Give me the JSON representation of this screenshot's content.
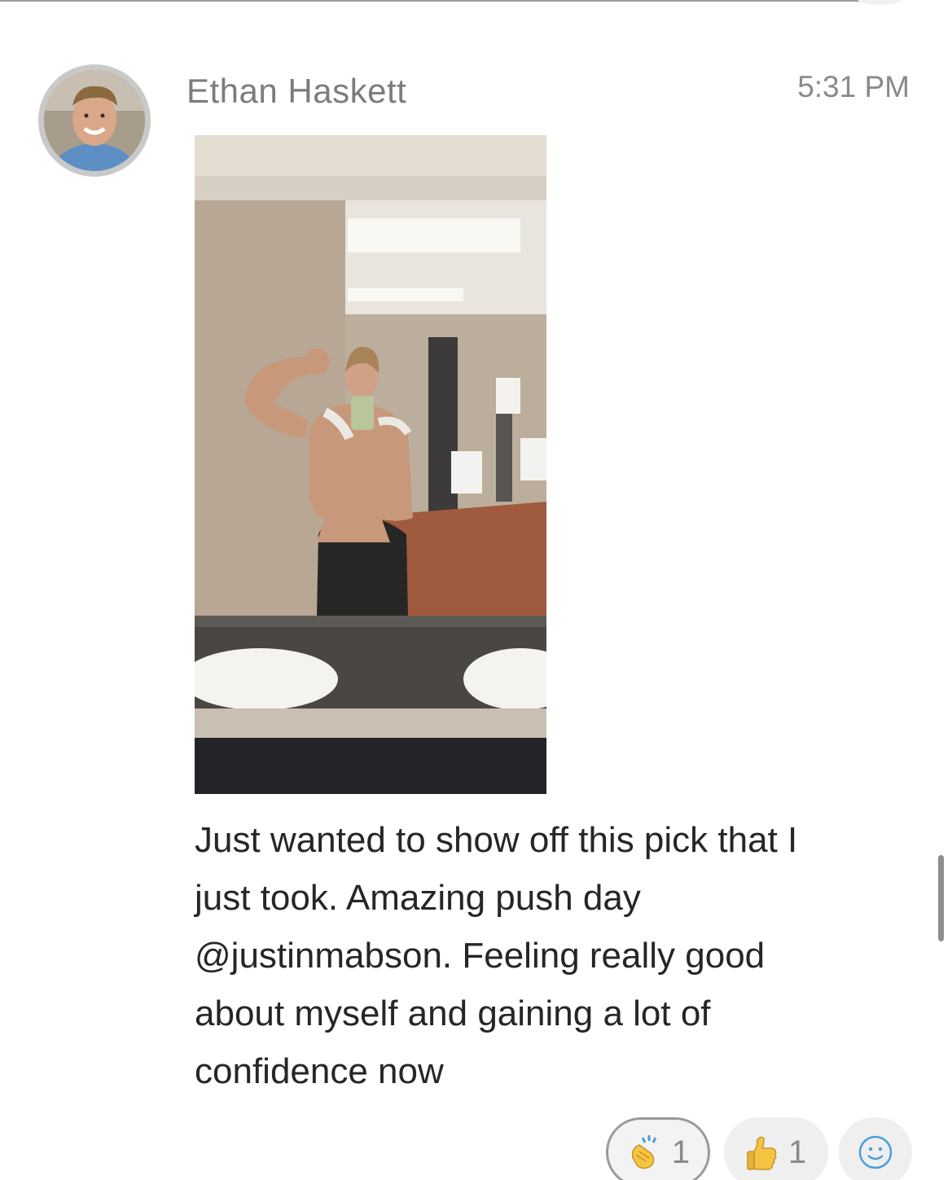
{
  "message": {
    "sender_name": "Ethan Haskett",
    "timestamp": "5:31 PM",
    "avatar_icon": "user-photo",
    "photo_icon": "gym-selfie-photo",
    "text_lines": [
      "Just wanted to show off this pick that I",
      "just took. Amazing push day",
      "@justinmabson. Feeling really good",
      "about myself and gaining a lot of",
      "confidence now"
    ]
  },
  "reactions": [
    {
      "icon": "clapping-hands-icon",
      "count": "1",
      "selected": true
    },
    {
      "icon": "thumbs-up-icon",
      "count": "1",
      "selected": false
    }
  ],
  "add_reaction_icon": "smiley-face-icon",
  "colors": {
    "name": "#7c7c7c",
    "text": "#262626",
    "smiley": "#4a9fd8",
    "emoji": "#f5c542"
  }
}
